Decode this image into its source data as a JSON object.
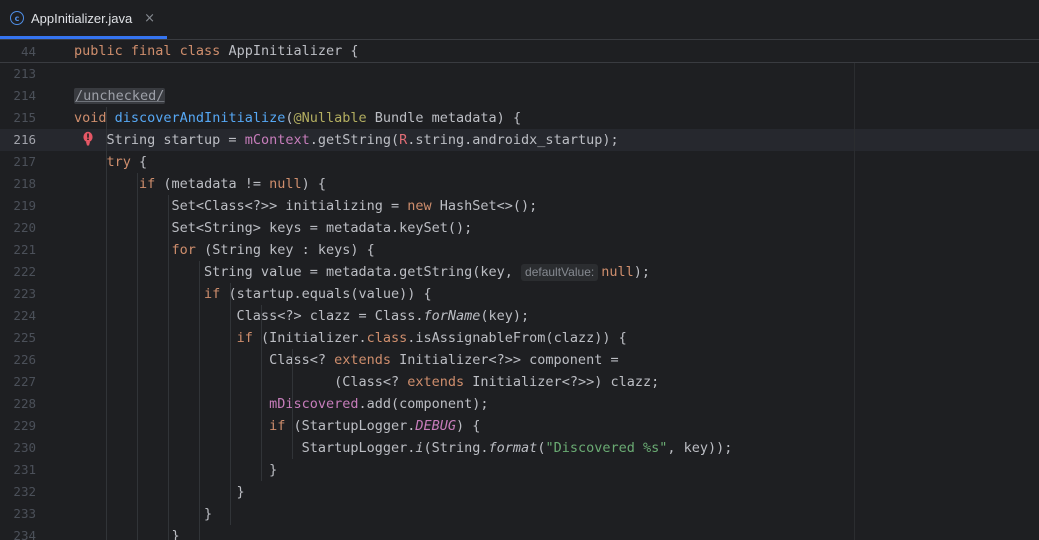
{
  "tab": {
    "label": "AppInitializer.java",
    "close": "×",
    "icon": "java-class-icon"
  },
  "sticky": {
    "line_number": "44",
    "text": "public final class AppInitializer {"
  },
  "colors": {
    "accent": "#3574f0",
    "keyword": "#cf8e6d",
    "function": "#56a8f5",
    "field": "#c77dbb",
    "string": "#6aab73",
    "annotation": "#b3ae60",
    "error": "#e55765"
  },
  "editor": {
    "current_line": "216",
    "lines": [
      {
        "n": "213",
        "code": ""
      },
      {
        "n": "214",
        "code": "<span class=\"insp\">/unchecked/</span>"
      },
      {
        "n": "215",
        "code": "<span class=\"kw\">void</span> <span class=\"fn\">discoverAndInitialize</span>(<span class=\"ann\">@Nullable</span> Bundle metadata) {"
      },
      {
        "n": "216",
        "code": "    String startup = <span class=\"fld\">mContext</span>.getString(<span class=\"rref\">R</span>.string.androidx_startup);"
      },
      {
        "n": "217",
        "code": "    <span class=\"kw\">try</span> {"
      },
      {
        "n": "218",
        "code": "        <span class=\"kw\">if</span> (metadata != <span class=\"kw\">null</span>) {"
      },
      {
        "n": "219",
        "code": "            Set&lt;Class&lt;?&gt;&gt; initializing = <span class=\"kw\">new</span> HashSet&lt;&gt;();"
      },
      {
        "n": "220",
        "code": "            Set&lt;String&gt; keys = metadata.keySet();"
      },
      {
        "n": "221",
        "code": "            <span class=\"kw\">for</span> (String key : keys) {"
      },
      {
        "n": "222",
        "code": "                String value = metadata.getString(key, <span class=\"hint\">defaultValue:</span><span class=\"kw\">null</span>);"
      },
      {
        "n": "223",
        "code": "                <span class=\"kw\">if</span> (startup.equals(value)) {"
      },
      {
        "n": "224",
        "code": "                    Class&lt;?&gt; clazz = Class.<span class=\"it\">forName</span>(key);"
      },
      {
        "n": "225",
        "code": "                    <span class=\"kw\">if</span> (Initializer.<span class=\"kw\">class</span>.isAssignableFrom(clazz)) {"
      },
      {
        "n": "226",
        "code": "                        Class&lt;? <span class=\"kw\">extends</span> Initializer&lt;?&gt;&gt; component ="
      },
      {
        "n": "227",
        "code": "                                (Class&lt;? <span class=\"kw\">extends</span> Initializer&lt;?&gt;&gt;) clazz;"
      },
      {
        "n": "228",
        "code": "                        <span class=\"fld\">mDiscovered</span>.add(component);"
      },
      {
        "n": "229",
        "code": "                        <span class=\"kw\">if</span> (StartupLogger.<span class=\"fld it\">DEBUG</span>) {"
      },
      {
        "n": "230",
        "code": "                            StartupLogger.<span class=\"it\">i</span>(String.<span class=\"it\">format</span>(<span class=\"str\">\"Discovered %s\"</span>, key));"
      },
      {
        "n": "231",
        "code": "                        }"
      },
      {
        "n": "232",
        "code": "                    }"
      },
      {
        "n": "233",
        "code": "                }"
      },
      {
        "n": "234",
        "code": "            }"
      }
    ]
  }
}
